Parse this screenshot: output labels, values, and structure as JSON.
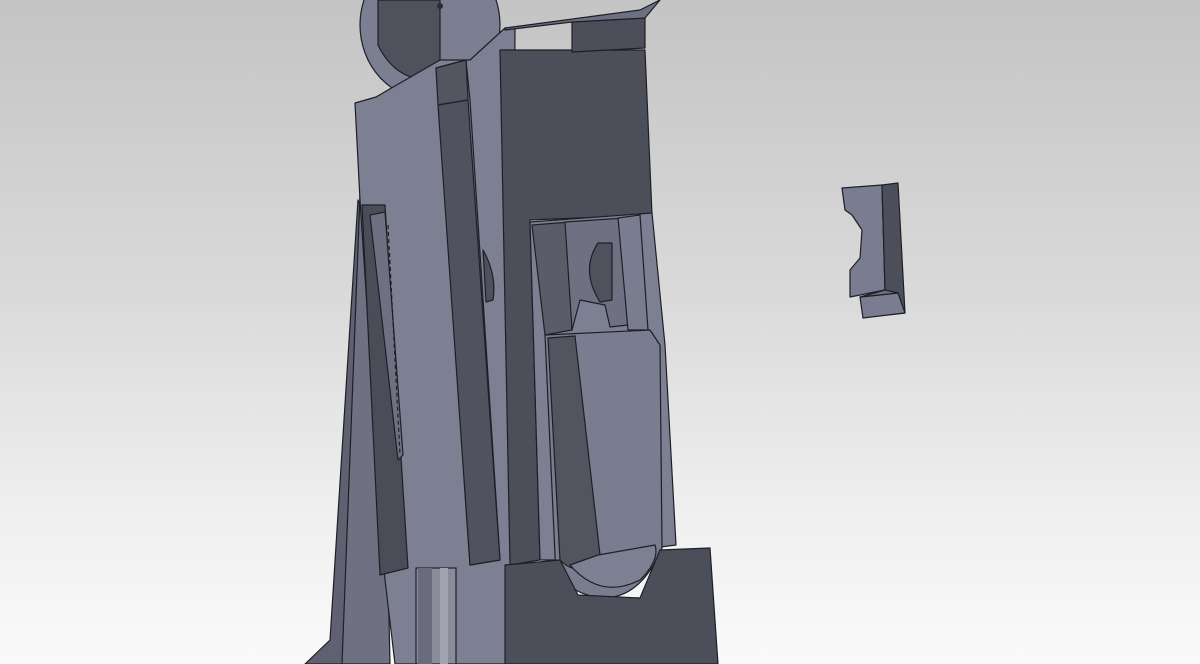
{
  "viewport": {
    "view": "cad-3d-model-viewport",
    "background": "light-gray-gradient",
    "part_colors": {
      "face_light": "#7d7f92",
      "face_mid": "#6d6f82",
      "face_dark": "#50525f",
      "face_darkest": "#45474f",
      "edge": "#1e1f26"
    }
  }
}
